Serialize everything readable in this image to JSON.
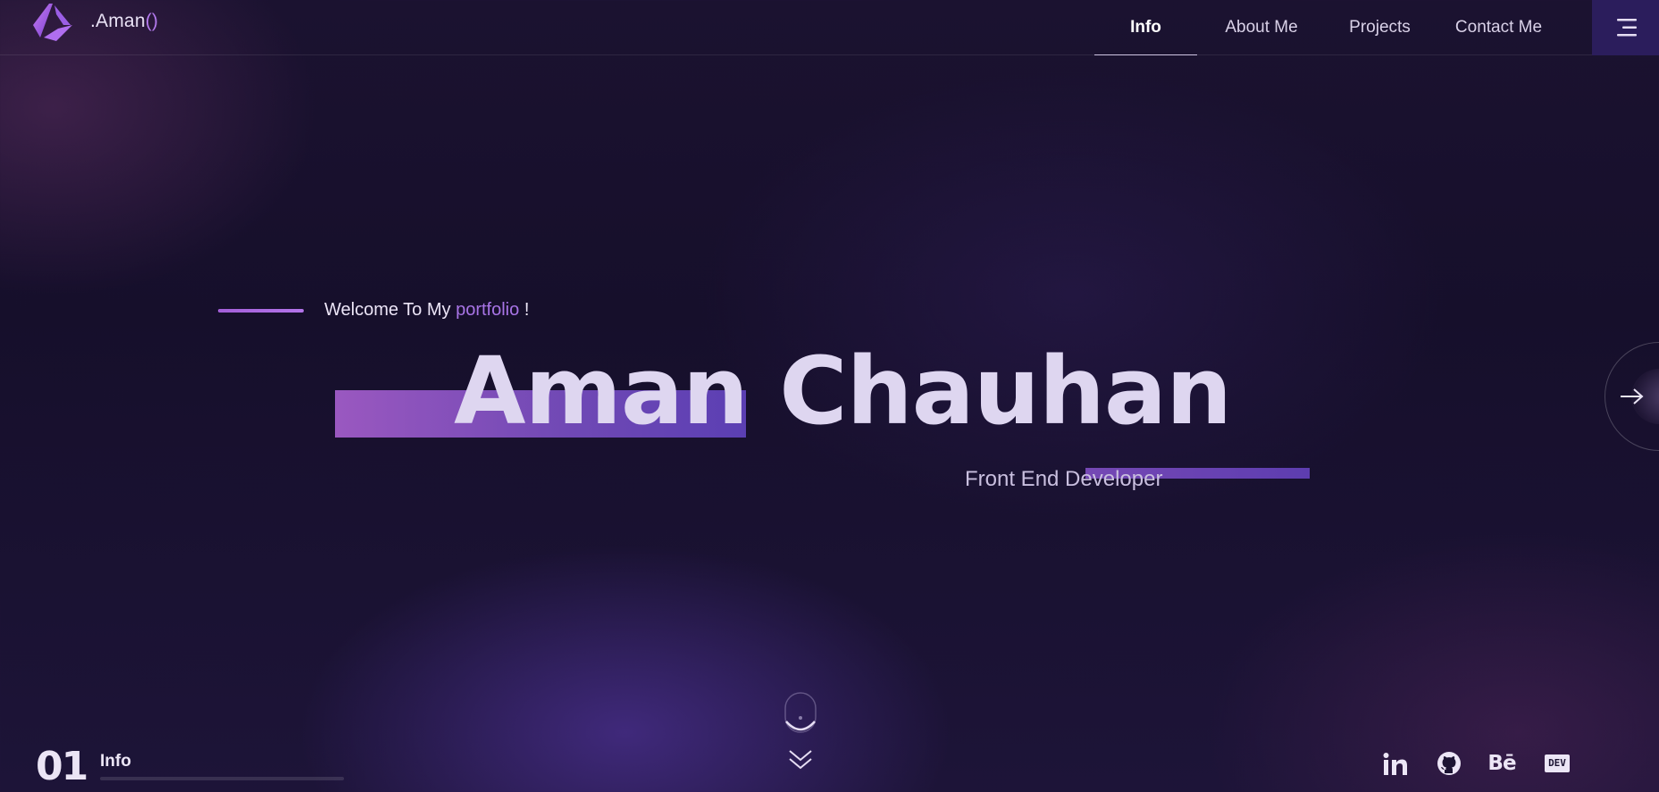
{
  "brand": {
    "logo_icon": "angular-diamond-logo-icon",
    "name_main": ".Aman",
    "name_paren": "()",
    "accent_color": "#b57bf0"
  },
  "nav": {
    "links": [
      {
        "label": "Info",
        "active": true
      },
      {
        "label": "About Me",
        "active": false
      },
      {
        "label": "Projects",
        "active": false
      },
      {
        "label": "Contact Me",
        "active": false
      }
    ],
    "menu_icon": "hamburger-menu-icon"
  },
  "hero": {
    "welcome_prefix": "Welcome To My",
    "welcome_accent": "portfolio",
    "welcome_suffix": "!",
    "name": "Aman Chauhan",
    "role": "Front End Developer",
    "next_icon": "arrow-right-icon"
  },
  "scroll": {
    "mouse_icon": "mouse-scroll-icon",
    "chevron_icon": "double-chevron-down-icon"
  },
  "section": {
    "number": "01",
    "label": "Info",
    "progress": 0.0
  },
  "social": [
    {
      "name": "linkedin",
      "icon": "linkedin-icon"
    },
    {
      "name": "github",
      "icon": "github-icon"
    },
    {
      "name": "behance",
      "icon": "behance-icon",
      "text": "Bē"
    },
    {
      "name": "dev",
      "icon": "dev-to-icon",
      "text": "DEV"
    }
  ],
  "colors": {
    "background": "#1a1230",
    "accent_purple": "#a874e6",
    "name_highlight": "#7149b5",
    "menu_bg": "#2b1d5c",
    "text_light": "#ded6f0"
  }
}
